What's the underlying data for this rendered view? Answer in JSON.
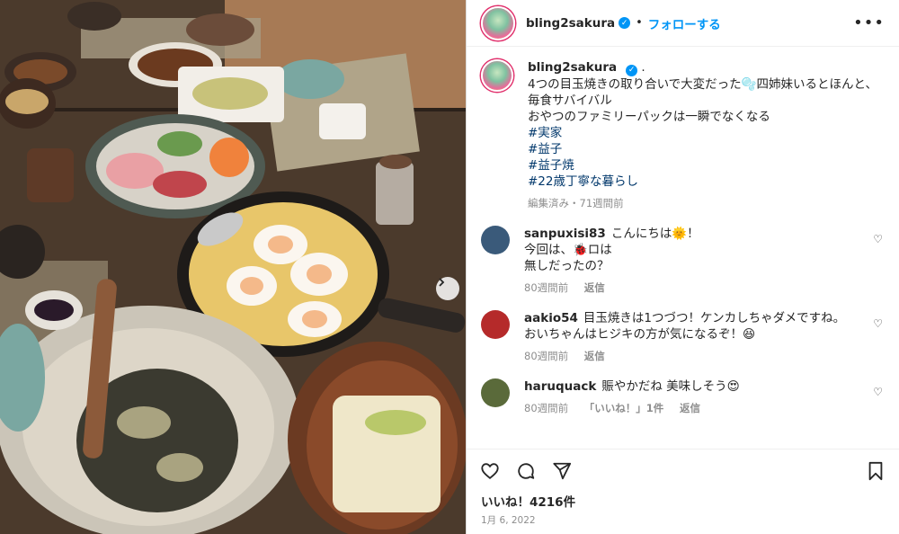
{
  "post": {
    "username": "bling2sakura",
    "follow_label": "フォローする",
    "dot": "•",
    "more_icon": "more-horizontal-icon",
    "caption": {
      "lines": [
        "4つの目玉焼きの取り合いで大変だった🫧四姉妹いるとほんと、毎食サバイバル",
        "おやつのファミリーパックは一瞬でなくなる"
      ],
      "hashtags": [
        "#実家",
        "#益子",
        "#益子焼",
        "#22歳丁寧な暮らし"
      ],
      "meta": "編集済み・71週間前"
    },
    "likes": "いいね！4216件",
    "date": "1月 6, 2022"
  },
  "comments": [
    {
      "username": "sanpuxisi83",
      "lines": [
        "こんにちは🌞！",
        "今回は、🐞ロは",
        "無しだったの？"
      ],
      "time": "80週間前",
      "reply": "返信",
      "likes": "",
      "avatar_color": "#3a5a7a"
    },
    {
      "username": "aakio54",
      "lines": [
        "目玉焼きは1つづつ！ケンカしちゃダメですね。",
        "おいちゃんはヒジキの方が気になるぞ！😆"
      ],
      "time": "80週間前",
      "reply": "返信",
      "likes": "",
      "avatar_color": "#b52a2a"
    },
    {
      "username": "haruquack",
      "lines": [
        "賑やかだね 美味しそう😍"
      ],
      "time": "80週間前",
      "reply": "返信",
      "likes": "「いいね！」1件",
      "avatar_color": "#5a6a3a"
    }
  ],
  "colors": {
    "accent": "#0095f6",
    "text": "#262626",
    "muted": "#8e8e8e",
    "hashtag": "#00376b"
  },
  "icons": {
    "like": "heart-icon",
    "comment": "comment-icon",
    "share": "paper-plane-icon",
    "save": "bookmark-icon",
    "carousel": "chevron-right-icon"
  }
}
